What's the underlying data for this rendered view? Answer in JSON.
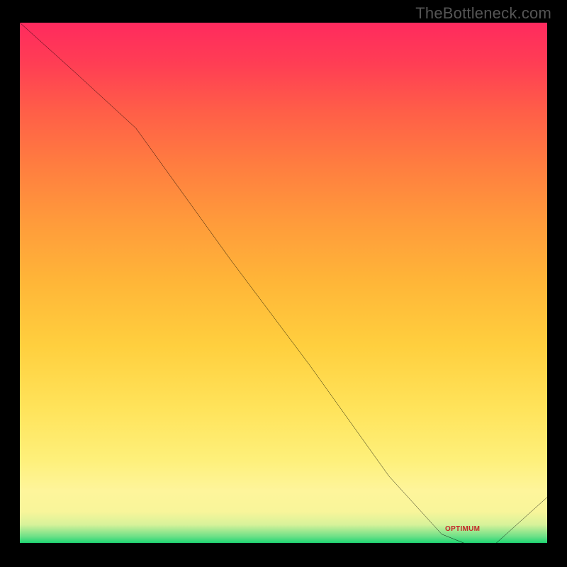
{
  "watermark": "TheBottleneck.com",
  "trough_label": "OPTIMUM",
  "colors": {
    "curve": "#000000",
    "trough_text": "#c62828"
  },
  "chart_data": {
    "type": "line",
    "title": "",
    "xlabel": "",
    "ylabel": "",
    "xlim": [
      0,
      100
    ],
    "ylim": [
      0,
      100
    ],
    "grid": false,
    "legend": false,
    "series": [
      {
        "name": "curve",
        "x": [
          0,
          10,
          22,
          40,
          55,
          70,
          80,
          85,
          90,
          100
        ],
        "y": [
          100,
          91,
          80,
          55,
          35,
          14,
          3,
          1,
          1,
          10
        ]
      }
    ],
    "background_gradient": {
      "direction": "vertical",
      "stops": [
        {
          "pos": 0.0,
          "color": "#1fd672"
        },
        {
          "pos": 0.05,
          "color": "#f8f59a"
        },
        {
          "pos": 0.3,
          "color": "#ffe35a"
        },
        {
          "pos": 0.55,
          "color": "#ffb638"
        },
        {
          "pos": 0.8,
          "color": "#ff6a44"
        },
        {
          "pos": 1.0,
          "color": "#ff2a5e"
        }
      ]
    },
    "annotations": [
      {
        "text": "OPTIMUM",
        "x": 87,
        "y": 2
      }
    ]
  }
}
